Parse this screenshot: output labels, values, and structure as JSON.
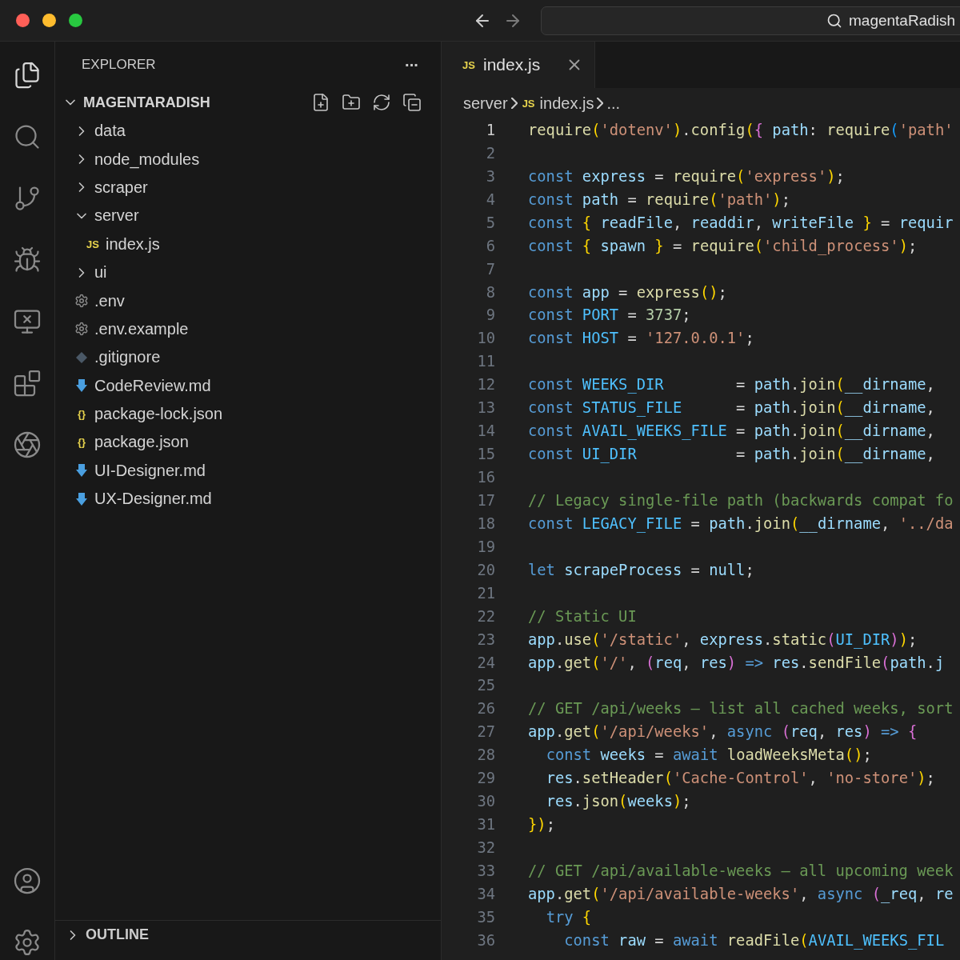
{
  "window": {
    "search": "magentaRadish"
  },
  "explorer": {
    "title": "EXPLORER",
    "more": "···",
    "root": {
      "label": "MAGENTARADISH",
      "expanded": true,
      "children": [
        {
          "kind": "folder",
          "label": "data",
          "expanded": false
        },
        {
          "kind": "folder",
          "label": "node_modules",
          "expanded": false
        },
        {
          "kind": "folder",
          "label": "scraper",
          "expanded": false
        },
        {
          "kind": "folder",
          "label": "server",
          "expanded": true,
          "children": [
            {
              "kind": "script",
              "icon_text": "JS",
              "label": "index.js"
            }
          ]
        },
        {
          "kind": "folder",
          "label": "ui",
          "expanded": false
        },
        {
          "kind": "settings",
          "label": ".env"
        },
        {
          "kind": "settings",
          "label": ".env.example"
        },
        {
          "kind": "gitignore",
          "label": ".gitignore"
        },
        {
          "kind": "markdown",
          "label": "CodeReview.md"
        },
        {
          "kind": "json",
          "icon_text": "{}",
          "label": "package-lock.json"
        },
        {
          "kind": "json",
          "icon_text": "{}",
          "label": "package.json"
        },
        {
          "kind": "markdown",
          "label": "UI-Designer.md"
        },
        {
          "kind": "markdown",
          "label": "UX-Designer.md"
        }
      ]
    },
    "sections": [
      {
        "label": "OUTLINE",
        "expanded": false
      }
    ]
  },
  "tabs": [
    {
      "label": "index.js",
      "icon_text": "JS",
      "selected": true
    }
  ],
  "breadcrumb": [
    {
      "label": "server"
    },
    {
      "label": "index.js",
      "icon_text": "JS"
    },
    {
      "label": "..."
    }
  ],
  "editor": {
    "lines": [
      {
        "n": "1",
        "active": true,
        "text": "require('dotenv').config({ path: require('path'"
      },
      {
        "n": "2",
        "active": false
      },
      {
        "n": "3",
        "active": false,
        "text": "const express = require('express');"
      },
      {
        "n": "4",
        "active": false,
        "text": "const path = require('path');"
      },
      {
        "n": "5",
        "active": false,
        "text": "const { readFile, readdir, writeFile } = requir"
      },
      {
        "n": "6",
        "active": false,
        "text": "const { spawn } = require('child_process');"
      },
      {
        "n": "7",
        "active": false
      },
      {
        "n": "8",
        "active": false,
        "text": "const app = express();"
      },
      {
        "n": "9",
        "active": false,
        "text": "const PORT = 3737;"
      },
      {
        "n": "10",
        "active": false,
        "text": "const HOST = '127.0.0.1';"
      },
      {
        "n": "11",
        "active": false
      },
      {
        "n": "12",
        "active": false,
        "text": "const WEEKS_DIR",
        "aligned_text": "= path.join(__dirname,"
      },
      {
        "n": "13",
        "active": false,
        "text": "const STATUS_FILE",
        "aligned_text": "= path.join(__dirname,"
      },
      {
        "n": "14",
        "active": false,
        "text": "const AVAIL_WEEKS_FILE",
        "aligned_text": "= path.join(__dirname,"
      },
      {
        "n": "15",
        "active": false,
        "text": "const UI_DIR",
        "aligned_text": "= path.join(__dirname,"
      },
      {
        "n": "16",
        "active": false
      },
      {
        "n": "17",
        "active": false,
        "text": "// Legacy single-file path (backwards compat fo"
      },
      {
        "n": "18",
        "active": false,
        "text": "const LEGACY_FILE = path.join(__dirname, '../da"
      },
      {
        "n": "19",
        "active": false
      },
      {
        "n": "20",
        "active": false,
        "text": "let scrapeProcess = null;"
      },
      {
        "n": "21",
        "active": false
      },
      {
        "n": "22",
        "active": false,
        "text": "// Static UI"
      },
      {
        "n": "23",
        "active": false,
        "text": "app.use('/static', express.static(UI_DIR));"
      },
      {
        "n": "24",
        "active": false,
        "text": "app.get('/', (req, res) => res.sendFile(path.j"
      },
      {
        "n": "25",
        "active": false
      },
      {
        "n": "26",
        "active": false,
        "text": "// GET /api/weeks — list all cached weeks, sort"
      },
      {
        "n": "27",
        "active": false,
        "text": "app.get('/api/weeks', async (req, res) => {"
      },
      {
        "n": "28",
        "active": false,
        "text": "  const weeks = await loadWeeksMeta();"
      },
      {
        "n": "29",
        "active": false,
        "text": "  res.setHeader('Cache-Control', 'no-store');"
      },
      {
        "n": "30",
        "active": false,
        "text": "  res.json(weeks);"
      },
      {
        "n": "31",
        "active": false,
        "text": "});"
      },
      {
        "n": "32",
        "active": false
      },
      {
        "n": "33",
        "active": false,
        "text": "// GET /api/available-weeks — all upcoming week"
      },
      {
        "n": "34",
        "active": false,
        "text": "app.get('/api/available-weeks', async (_req, re"
      },
      {
        "n": "35",
        "active": false,
        "text": "  try {"
      },
      {
        "n": "36",
        "active": false,
        "text": "    const raw = await readFile(AVAIL_WEEKS_FIL"
      }
    ]
  }
}
